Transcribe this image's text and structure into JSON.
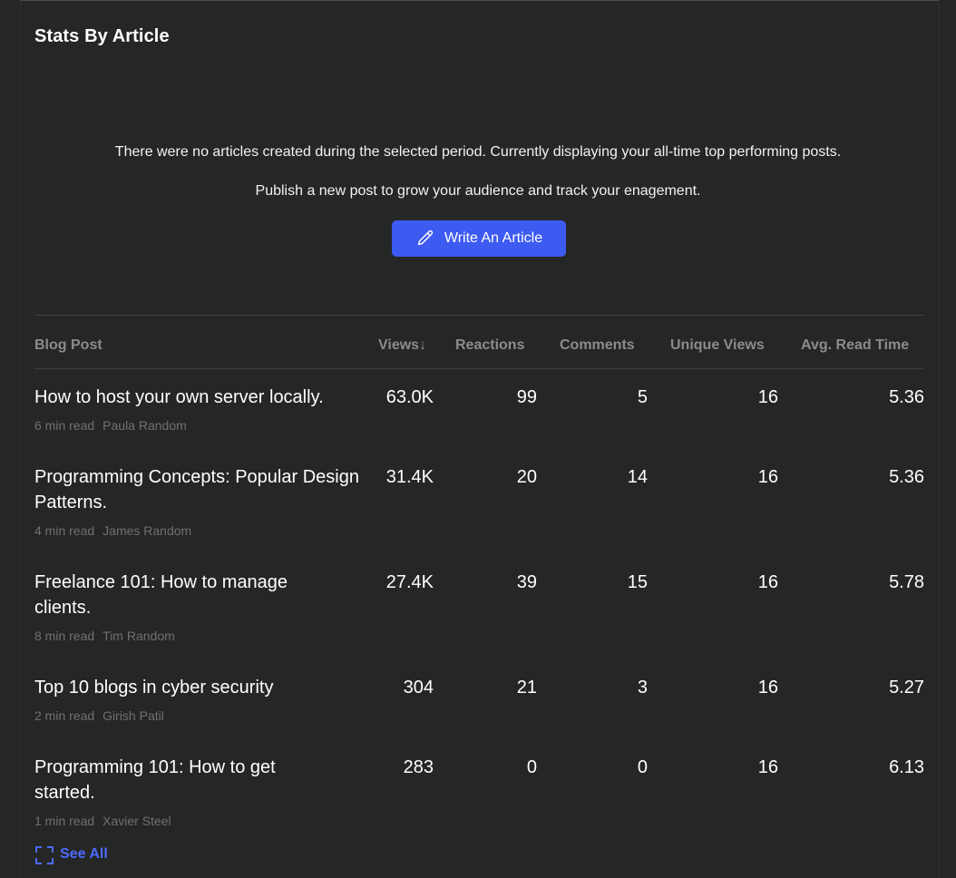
{
  "section": {
    "title": "Stats By Article"
  },
  "notice": {
    "line1": "There were no articles created during the selected period. Currently displaying your all-time top performing posts.",
    "line2": "Publish a new post to grow your audience and track your enagement."
  },
  "write_button": {
    "label": "Write An Article",
    "icon": "pencil-icon",
    "color": "#3d5af1"
  },
  "table": {
    "columns": {
      "post": "Blog Post",
      "views": "Views",
      "reactions": "Reactions",
      "comments": "Comments",
      "unique_views": "Unique Views",
      "avg_read_time": "Avg. Read Time"
    },
    "sort_indicator": "↓",
    "rows": [
      {
        "title": "How to host your own server locally.",
        "read_time": "6 min read",
        "author": "Paula Random",
        "views": "63.0K",
        "reactions": "99",
        "comments": "5",
        "unique_views": "16",
        "avg_read_time": "5.36"
      },
      {
        "title": "Programming Concepts: Popular Design Patterns.",
        "read_time": "4 min read",
        "author": "James Random",
        "views": "31.4K",
        "reactions": "20",
        "comments": "14",
        "unique_views": "16",
        "avg_read_time": "5.36"
      },
      {
        "title": "Freelance 101: How to manage clients.",
        "read_time": "8 min read",
        "author": "Tim Random",
        "views": "27.4K",
        "reactions": "39",
        "comments": "15",
        "unique_views": "16",
        "avg_read_time": "5.78"
      },
      {
        "title": "Top 10 blogs in cyber security",
        "read_time": "2 min read",
        "author": "Girish Patil",
        "views": "304",
        "reactions": "21",
        "comments": "3",
        "unique_views": "16",
        "avg_read_time": "5.27"
      },
      {
        "title": "Programming 101: How to get started.",
        "read_time": "1 min read",
        "author": "Xavier Steel",
        "views": "283",
        "reactions": "0",
        "comments": "0",
        "unique_views": "16",
        "avg_read_time": "6.13"
      }
    ]
  },
  "see_all": {
    "label": "See All",
    "icon": "expand-icon",
    "color": "#4d6bff"
  }
}
